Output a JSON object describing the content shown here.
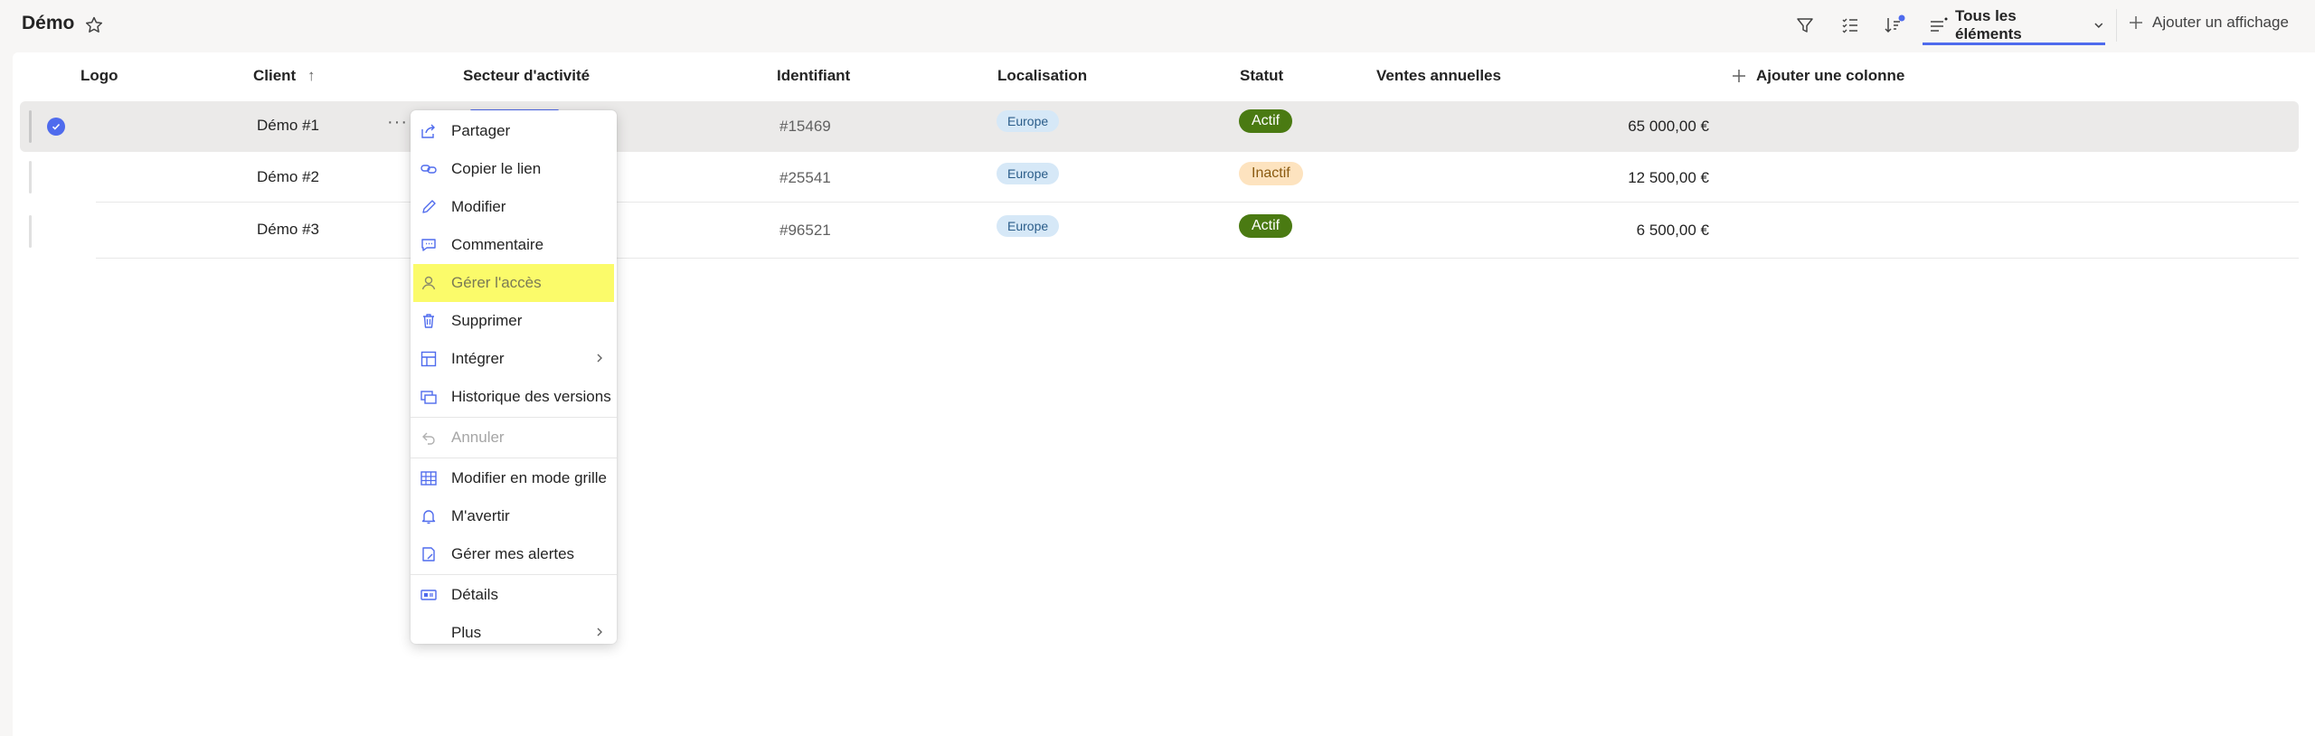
{
  "header": {
    "title": "Démo",
    "current_view": "Tous les éléments",
    "add_view": "Ajouter un affichage"
  },
  "columns": [
    "Logo",
    "Client",
    "Secteur d'activité",
    "Identifiant",
    "Localisation",
    "Statut",
    "Ventes annuelles",
    "Ajouter une colonne"
  ],
  "sort_indicator": "↑",
  "rows": [
    {
      "client": "Démo #1",
      "id": "#15469",
      "location": "Europe",
      "status": "Actif",
      "sales": "65 000,00 €",
      "selected": true
    },
    {
      "client": "Démo #2",
      "id": "#25541",
      "location": "Europe",
      "status": "Inactif",
      "sales": "12 500,00 €",
      "selected": false
    },
    {
      "client": "Démo #3",
      "id": "#96521",
      "location": "Europe",
      "status": "Actif",
      "sales": "6 500,00 €",
      "selected": false
    }
  ],
  "row_more": "···",
  "menu": {
    "items": [
      {
        "label": "Partager",
        "icon": "share-icon"
      },
      {
        "label": "Copier le lien",
        "icon": "link-icon"
      },
      {
        "label": "Modifier",
        "icon": "pencil-icon"
      },
      {
        "label": "Commentaire",
        "icon": "comment-icon"
      },
      {
        "label": "Gérer l'accès",
        "icon": "person-icon"
      },
      {
        "label": "Supprimer",
        "icon": "trash-icon"
      },
      {
        "label": "Intégrer",
        "icon": "embed-icon"
      },
      {
        "label": "Historique des versions",
        "icon": "history-icon"
      },
      {
        "label": "Annuler",
        "icon": "undo-icon"
      },
      {
        "label": "Modifier en mode grille",
        "icon": "grid-icon"
      },
      {
        "label": "M'avertir",
        "icon": "bell-icon"
      },
      {
        "label": "Gérer mes alertes",
        "icon": "alerts-icon"
      },
      {
        "label": "Détails",
        "icon": "details-icon"
      },
      {
        "label": "Plus",
        "icon": ""
      }
    ]
  },
  "colors": {
    "accent": "#4f6bed",
    "highlight": "#fbfb6a",
    "actif": "#4a7a12",
    "inactif": "#fde3bf",
    "location_pill": "#d6e8f7"
  }
}
